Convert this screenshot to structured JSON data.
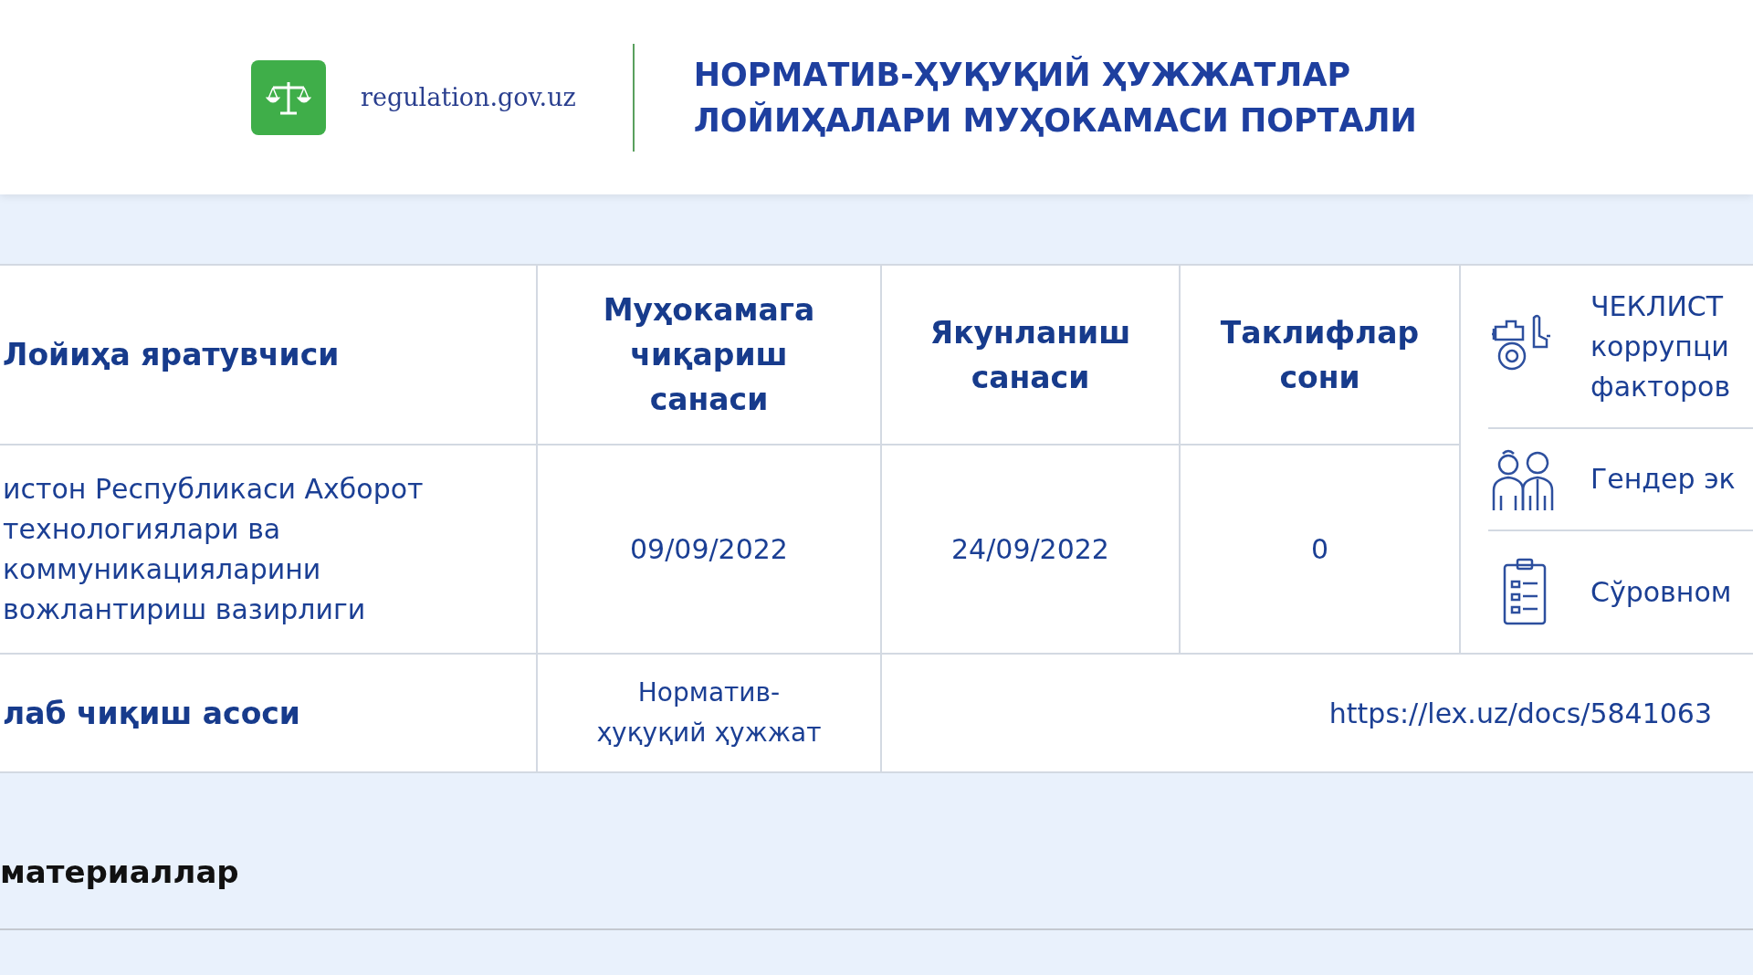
{
  "header": {
    "logo_text": "regulation.gov.uz",
    "title": "НОРМАТИВ-ҲУҚУҚИЙ ҲУЖЖАТЛАР\nЛОЙИҲАЛАРИ МУҲОКАМАСИ ПОРТАЛИ"
  },
  "table": {
    "columns": [
      "Лойиҳа яратувчиси",
      "Муҳокамага\nчиқариш\nсанаси",
      "Якунланиш\nсанаси",
      "Таклифлар\nсони"
    ],
    "row": [
      "истон Республикаси Ахборот\n   технологиялари ва\nкоммуникацияларини\nвожлантириш вазирлиги",
      "09/09/2022",
      "24/09/2022",
      "0"
    ],
    "basis": {
      "label": "лаб чиқиш асоси",
      "type": "Норматив-\nҳуқуқий ҳужжат",
      "link": "https://lex.uz/docs/5841063"
    }
  },
  "side_panel": {
    "items": [
      {
        "label": "ЧЕКЛИСТ\nкоррупци\nфакторов"
      },
      {
        "label": "Гендер эк"
      },
      {
        "label": "Сўровном"
      }
    ]
  },
  "section_title": "материаллар"
}
